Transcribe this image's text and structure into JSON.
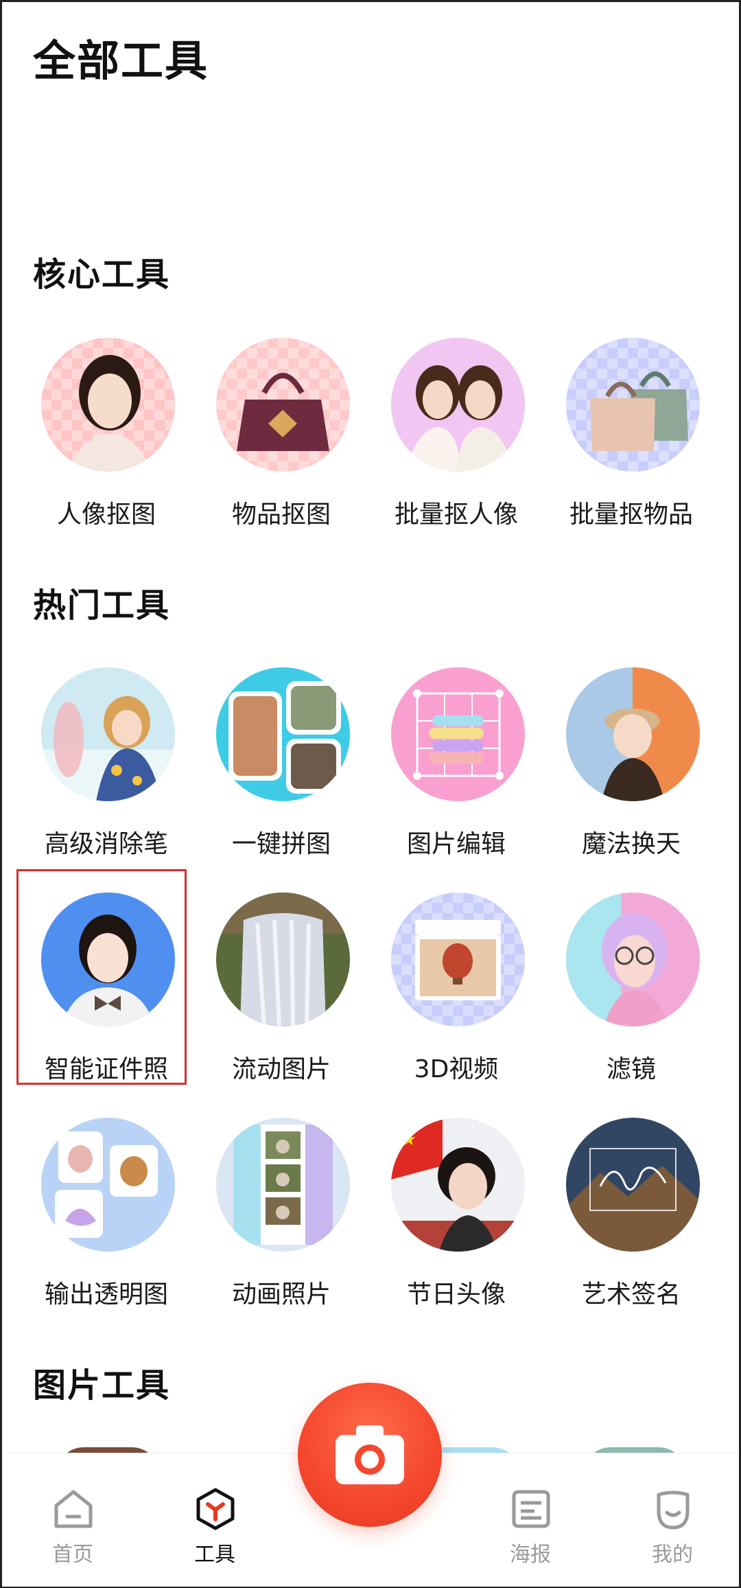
{
  "header": {
    "title": "全部工具"
  },
  "sections": {
    "core": {
      "title": "核心工具",
      "items": [
        {
          "label": "人像抠图",
          "icon": "portrait-cutout-icon"
        },
        {
          "label": "物品抠图",
          "icon": "object-cutout-icon"
        },
        {
          "label": "批量抠人像",
          "icon": "batch-portrait-cutout-icon"
        },
        {
          "label": "批量抠物品",
          "icon": "batch-object-cutout-icon"
        }
      ]
    },
    "hot": {
      "title": "热门工具",
      "items": [
        {
          "label": "高级消除笔",
          "icon": "eraser-pen-icon"
        },
        {
          "label": "一键拼图",
          "icon": "collage-icon"
        },
        {
          "label": "图片编辑",
          "icon": "image-edit-icon"
        },
        {
          "label": "魔法换天",
          "icon": "sky-replace-icon"
        },
        {
          "label": "智能证件照",
          "icon": "id-photo-icon"
        },
        {
          "label": "流动图片",
          "icon": "flowing-image-icon"
        },
        {
          "label": "3D视频",
          "icon": "3d-video-icon"
        },
        {
          "label": "滤镜",
          "icon": "filter-icon"
        },
        {
          "label": "输出透明图",
          "icon": "transparent-output-icon"
        },
        {
          "label": "动画照片",
          "icon": "animated-photo-icon"
        },
        {
          "label": "节日头像",
          "icon": "festival-avatar-icon"
        },
        {
          "label": "艺术签名",
          "icon": "art-signature-icon"
        }
      ]
    },
    "image": {
      "title": "图片工具"
    }
  },
  "tabbar": {
    "tabs": [
      {
        "label": "首页",
        "icon": "home-icon"
      },
      {
        "label": "工具",
        "icon": "tools-icon",
        "active": true
      },
      {
        "label": "海报",
        "icon": "poster-icon"
      },
      {
        "label": "我的",
        "icon": "profile-icon"
      }
    ],
    "center_icon": "camera-icon"
  },
  "colors": {
    "accent": "#f4472d",
    "highlight_border": "#d32f2f",
    "inactive_tab": "#9a9a9a"
  }
}
